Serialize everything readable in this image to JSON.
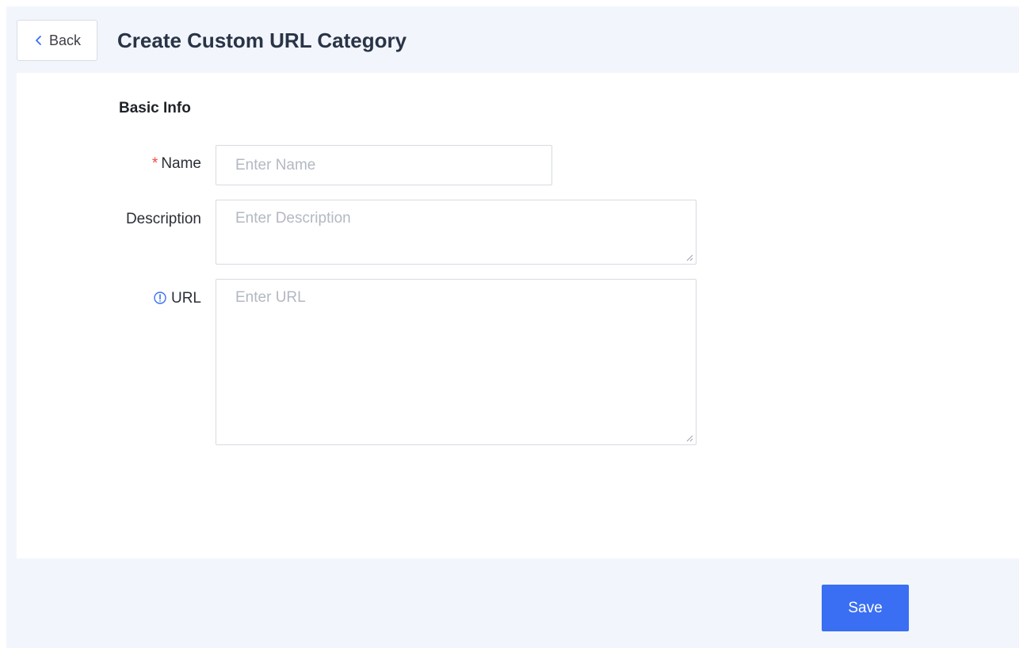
{
  "header": {
    "back_label": "Back",
    "title": "Create Custom URL Category"
  },
  "form": {
    "section_title": "Basic Info",
    "name": {
      "required_mark": "*",
      "label": "Name",
      "placeholder": "Enter Name",
      "value": ""
    },
    "description": {
      "label": "Description",
      "placeholder": "Enter Description",
      "value": ""
    },
    "url": {
      "icon": "info-circle-icon",
      "label": "URL",
      "placeholder": "Enter URL",
      "value": ""
    }
  },
  "footer": {
    "save_label": "Save"
  },
  "colors": {
    "page_background": "#f2f6fc",
    "primary": "#3a6ff3",
    "required": "#f5483b",
    "info_icon": "#3a6ff3"
  }
}
